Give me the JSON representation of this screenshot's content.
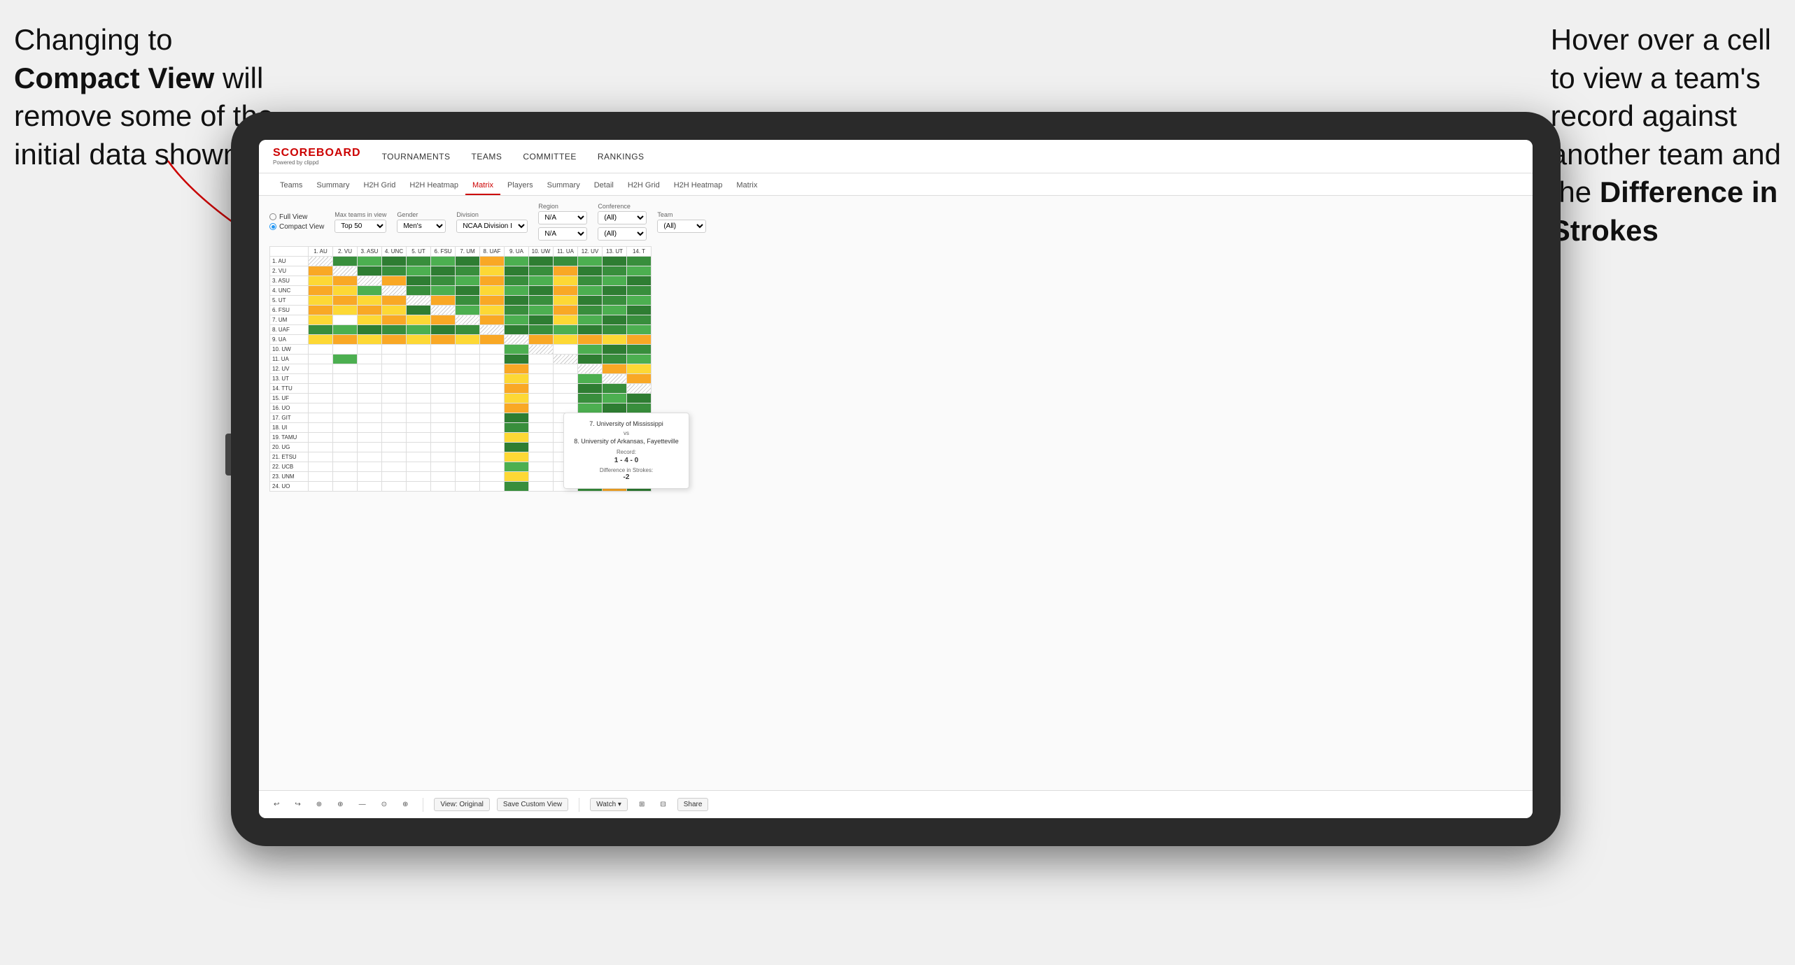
{
  "annotations": {
    "left_line1": "Changing to",
    "left_line2_bold": "Compact View",
    "left_line2_rest": " will",
    "left_line3": "remove some of the",
    "left_line4": "initial data shown",
    "right_line1": "Hover over a cell",
    "right_line2": "to view a team's",
    "right_line3": "record against",
    "right_line4": "another team and",
    "right_line5_pre": "the ",
    "right_line5_bold": "Difference in",
    "right_line6_bold": "Strokes"
  },
  "app": {
    "logo": "SCOREBOARD",
    "logo_sub": "Powered by clippd",
    "nav": [
      "TOURNAMENTS",
      "TEAMS",
      "COMMITTEE",
      "RANKINGS"
    ]
  },
  "tabs": {
    "main_tabs": [
      "Teams",
      "Summary",
      "H2H Grid",
      "H2H Heatmap",
      "Matrix",
      "Players",
      "Summary",
      "Detail",
      "H2H Grid",
      "H2H Heatmap",
      "Matrix"
    ],
    "active_tab": "Matrix"
  },
  "controls": {
    "view_options": [
      "Full View",
      "Compact View"
    ],
    "selected_view": "Compact View",
    "max_teams_label": "Max teams in view",
    "max_teams_value": "Top 50",
    "gender_label": "Gender",
    "gender_value": "Men's",
    "division_label": "Division",
    "division_value": "NCAA Division I",
    "region_label": "Region",
    "region_value": "N/A",
    "conference_label": "Conference",
    "conference_values": [
      "(All)",
      "(All)"
    ],
    "team_label": "Team",
    "team_value": "(All)"
  },
  "matrix": {
    "col_headers": [
      "1. AU",
      "2. VU",
      "3. ASU",
      "4. UNC",
      "5. UT",
      "6. FSU",
      "7. UM",
      "8. UAF",
      "9. UA",
      "10. UW",
      "11. UA",
      "12. UV",
      "13. UT",
      "14. T"
    ],
    "rows": [
      {
        "label": "1. AU",
        "cells": [
          "diag",
          "g",
          "g",
          "g",
          "g",
          "g",
          "g",
          "y",
          "g",
          "g",
          "g",
          "g",
          "g",
          "g"
        ]
      },
      {
        "label": "2. VU",
        "cells": [
          "y",
          "diag",
          "g",
          "g",
          "g",
          "g",
          "g",
          "y",
          "g",
          "g",
          "y",
          "g",
          "g",
          "g"
        ]
      },
      {
        "label": "3. ASU",
        "cells": [
          "y",
          "y",
          "diag",
          "y",
          "g",
          "g",
          "g",
          "y",
          "g",
          "g",
          "y",
          "g",
          "g",
          "g"
        ]
      },
      {
        "label": "4. UNC",
        "cells": [
          "y",
          "y",
          "g",
          "diag",
          "g",
          "g",
          "g",
          "y",
          "g",
          "g",
          "y",
          "g",
          "g",
          "g"
        ]
      },
      {
        "label": "5. UT",
        "cells": [
          "y",
          "y",
          "y",
          "y",
          "diag",
          "y",
          "g",
          "y",
          "g",
          "g",
          "y",
          "g",
          "g",
          "g"
        ]
      },
      {
        "label": "6. FSU",
        "cells": [
          "y",
          "y",
          "y",
          "y",
          "g",
          "diag",
          "g",
          "y",
          "g",
          "g",
          "y",
          "g",
          "g",
          "g"
        ]
      },
      {
        "label": "7. UM",
        "cells": [
          "y",
          "w",
          "y",
          "y",
          "y",
          "y",
          "diag",
          "y",
          "g",
          "g",
          "y",
          "g",
          "g",
          "g"
        ]
      },
      {
        "label": "8. UAF",
        "cells": [
          "g",
          "g",
          "g",
          "g",
          "g",
          "g",
          "g",
          "diag",
          "g",
          "g",
          "g",
          "g",
          "g",
          "g"
        ]
      },
      {
        "label": "9. UA",
        "cells": [
          "y",
          "y",
          "y",
          "y",
          "y",
          "y",
          "y",
          "y",
          "diag",
          "y",
          "y",
          "y",
          "y",
          "y"
        ]
      },
      {
        "label": "10. UW",
        "cells": [
          "w",
          "w",
          "w",
          "w",
          "w",
          "w",
          "w",
          "w",
          "g",
          "diag",
          "w",
          "g",
          "g",
          "g"
        ]
      },
      {
        "label": "11. UA",
        "cells": [
          "w",
          "g",
          "w",
          "w",
          "w",
          "w",
          "w",
          "w",
          "g",
          "w",
          "diag",
          "g",
          "g",
          "g"
        ]
      },
      {
        "label": "12. UV",
        "cells": [
          "w",
          "w",
          "w",
          "w",
          "w",
          "w",
          "w",
          "w",
          "y",
          "w",
          "w",
          "diag",
          "y",
          "y"
        ]
      },
      {
        "label": "13. UT",
        "cells": [
          "w",
          "w",
          "w",
          "w",
          "w",
          "w",
          "w",
          "w",
          "y",
          "w",
          "w",
          "g",
          "diag",
          "y"
        ]
      },
      {
        "label": "14. TTU",
        "cells": [
          "w",
          "w",
          "w",
          "w",
          "w",
          "w",
          "w",
          "w",
          "y",
          "w",
          "w",
          "g",
          "g",
          "diag"
        ]
      },
      {
        "label": "15. UF",
        "cells": [
          "w",
          "w",
          "w",
          "w",
          "w",
          "w",
          "w",
          "w",
          "y",
          "w",
          "w",
          "g",
          "g",
          "g"
        ]
      },
      {
        "label": "16. UO",
        "cells": [
          "w",
          "w",
          "w",
          "w",
          "w",
          "w",
          "w",
          "w",
          "y",
          "w",
          "w",
          "g",
          "g",
          "g"
        ]
      },
      {
        "label": "17. GIT",
        "cells": [
          "w",
          "w",
          "w",
          "w",
          "w",
          "w",
          "w",
          "w",
          "g",
          "w",
          "w",
          "g",
          "g",
          "g"
        ]
      },
      {
        "label": "18. UI",
        "cells": [
          "w",
          "w",
          "w",
          "w",
          "w",
          "w",
          "w",
          "w",
          "g",
          "w",
          "w",
          "g",
          "g",
          "g"
        ]
      },
      {
        "label": "19. TAMU",
        "cells": [
          "w",
          "w",
          "w",
          "w",
          "w",
          "w",
          "w",
          "w",
          "y",
          "w",
          "w",
          "g",
          "g",
          "g"
        ]
      },
      {
        "label": "20. UG",
        "cells": [
          "w",
          "w",
          "w",
          "w",
          "w",
          "w",
          "w",
          "w",
          "g",
          "w",
          "w",
          "g",
          "g",
          "g"
        ]
      },
      {
        "label": "21. ETSU",
        "cells": [
          "w",
          "w",
          "w",
          "w",
          "w",
          "w",
          "w",
          "w",
          "y",
          "w",
          "w",
          "g",
          "g",
          "g"
        ]
      },
      {
        "label": "22. UCB",
        "cells": [
          "w",
          "w",
          "w",
          "w",
          "w",
          "w",
          "w",
          "w",
          "g",
          "w",
          "w",
          "g",
          "g",
          "g"
        ]
      },
      {
        "label": "23. UNM",
        "cells": [
          "w",
          "w",
          "w",
          "w",
          "w",
          "w",
          "w",
          "w",
          "y",
          "w",
          "w",
          "g",
          "g",
          "g"
        ]
      },
      {
        "label": "24. UO",
        "cells": [
          "w",
          "w",
          "w",
          "w",
          "w",
          "w",
          "w",
          "w",
          "g",
          "w",
          "w",
          "g",
          "y",
          "g"
        ]
      }
    ]
  },
  "tooltip": {
    "team1": "7. University of Mississippi",
    "vs": "vs",
    "team2": "8. University of Arkansas, Fayetteville",
    "record_label": "Record:",
    "record_value": "1 - 4 - 0",
    "strokes_label": "Difference in Strokes:",
    "strokes_value": "-2"
  },
  "toolbar": {
    "undo": "↩",
    "redo": "↪",
    "btn1": "⊕",
    "btn2": "⊕",
    "btn3": "—",
    "btn4": "⊕",
    "btn5": "⊙",
    "view_original": "View: Original",
    "save_custom": "Save Custom View",
    "watch": "Watch ▾",
    "share": "Share"
  }
}
